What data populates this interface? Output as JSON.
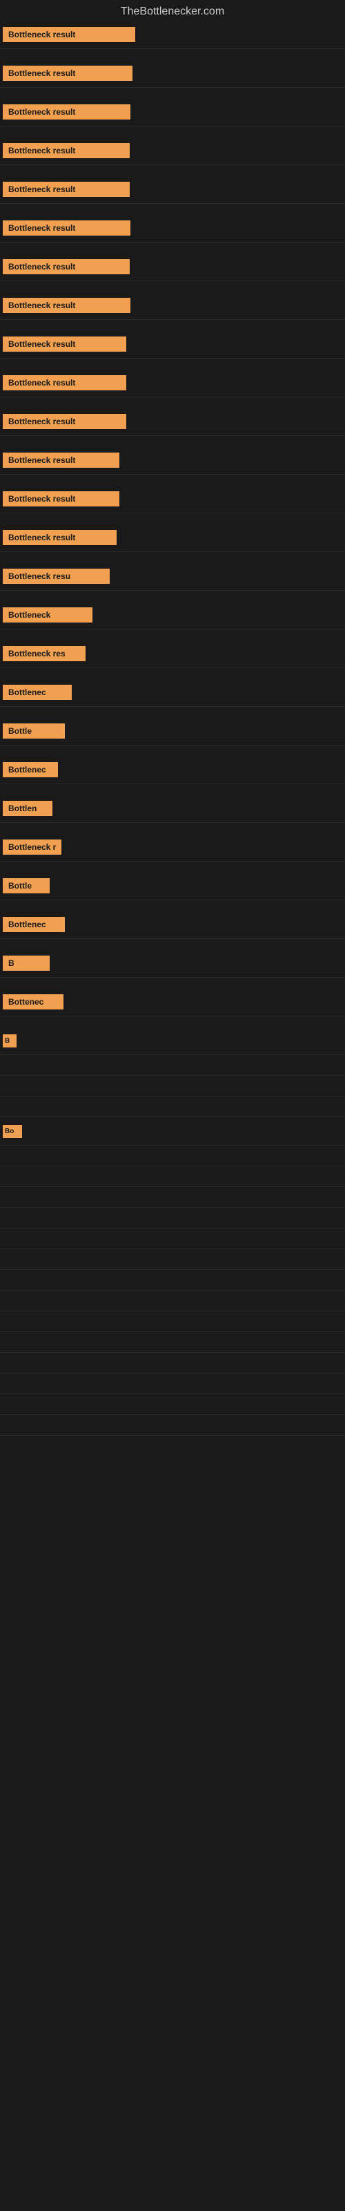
{
  "site": {
    "title": "TheBottlenecker.com"
  },
  "items": [
    {
      "id": 1,
      "label": "Bottleneck result"
    },
    {
      "id": 2,
      "label": "Bottleneck result"
    },
    {
      "id": 3,
      "label": "Bottleneck result"
    },
    {
      "id": 4,
      "label": "Bottleneck result"
    },
    {
      "id": 5,
      "label": "Bottleneck result"
    },
    {
      "id": 6,
      "label": "Bottleneck result"
    },
    {
      "id": 7,
      "label": "Bottleneck result"
    },
    {
      "id": 8,
      "label": "Bottleneck result"
    },
    {
      "id": 9,
      "label": "Bottleneck result"
    },
    {
      "id": 10,
      "label": "Bottleneck result"
    },
    {
      "id": 11,
      "label": "Bottleneck result"
    },
    {
      "id": 12,
      "label": "Bottleneck result"
    },
    {
      "id": 13,
      "label": "Bottleneck result"
    },
    {
      "id": 14,
      "label": "Bottleneck result"
    },
    {
      "id": 15,
      "label": "Bottleneck resu"
    },
    {
      "id": 16,
      "label": "Bottleneck"
    },
    {
      "id": 17,
      "label": "Bottleneck res"
    },
    {
      "id": 18,
      "label": "Bottlenec"
    },
    {
      "id": 19,
      "label": "Bottle"
    },
    {
      "id": 20,
      "label": "Bottlenec"
    },
    {
      "id": 21,
      "label": "Bottlen"
    },
    {
      "id": 22,
      "label": "Bottleneck r"
    },
    {
      "id": 23,
      "label": "Bottle"
    },
    {
      "id": 24,
      "label": "Bottlenec"
    },
    {
      "id": 25,
      "label": "B"
    },
    {
      "id": 26,
      "label": "Bottenec"
    },
    {
      "id": 27,
      "label": "B"
    },
    {
      "id": 28,
      "label": ""
    },
    {
      "id": 29,
      "label": ""
    },
    {
      "id": 30,
      "label": ""
    },
    {
      "id": 31,
      "label": "Bo"
    },
    {
      "id": 32,
      "label": ""
    },
    {
      "id": 33,
      "label": ""
    },
    {
      "id": 34,
      "label": ""
    },
    {
      "id": 35,
      "label": ""
    },
    {
      "id": 36,
      "label": ""
    }
  ]
}
